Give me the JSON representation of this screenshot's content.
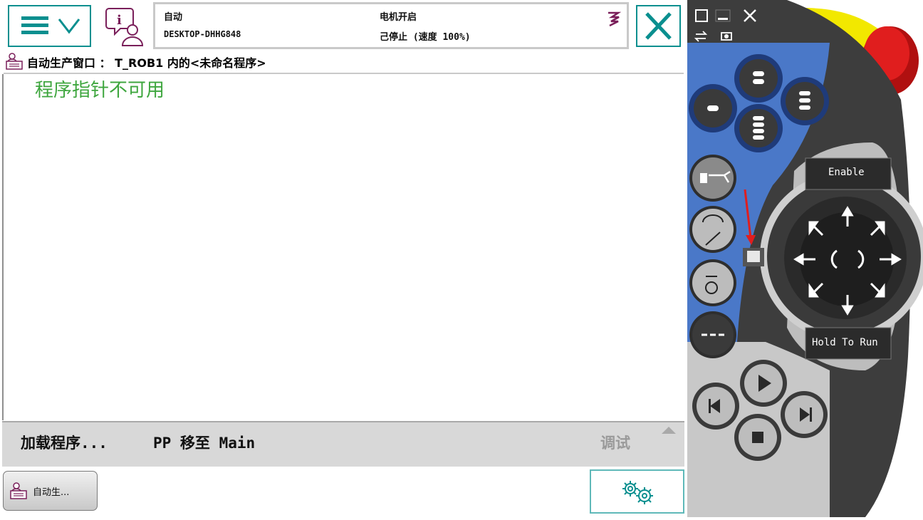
{
  "status": {
    "mode": "自动",
    "controller": "DESKTOP-DHHG848",
    "motors": "电机开启",
    "state": "己停止 (速度 100%)"
  },
  "window": {
    "title": "自动生产窗口 ： T_ROB1 内的<未命名程序>"
  },
  "content": {
    "message": "程序指针不可用"
  },
  "commands": {
    "load_program": "加载程序...",
    "pp_to_main": "PP 移至 Main",
    "debug": "调试"
  },
  "taskbar": {
    "tab_label": "自动生..."
  },
  "pendant": {
    "enable_label": "Enable",
    "hold_to_run_label": "Hold To Run"
  },
  "colors": {
    "teal": "#0a8f8f",
    "pp_message_green": "#3ea63e",
    "pendant_blue": "#4a78c8",
    "pendant_dark": "#3d3d3d",
    "estop_red": "#d11a1a",
    "yellow": "#f2e800"
  }
}
